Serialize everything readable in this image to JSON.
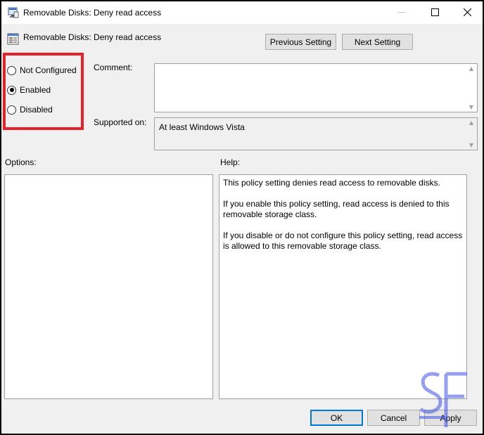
{
  "window": {
    "title": "Removable Disks: Deny read access",
    "controls": {
      "minimize": "—",
      "maximize": "☐",
      "close": "✕"
    }
  },
  "header": {
    "policy_name": "Removable Disks: Deny read access",
    "previous_label": "Previous Setting",
    "next_label": "Next Setting"
  },
  "state": {
    "options": [
      {
        "label": "Not Configured",
        "selected": false
      },
      {
        "label": "Enabled",
        "selected": true
      },
      {
        "label": "Disabled",
        "selected": false
      }
    ],
    "highlight_color": "#e8202a"
  },
  "comment": {
    "label": "Comment:",
    "value": ""
  },
  "supported": {
    "label": "Supported on:",
    "value": "At least Windows Vista"
  },
  "options_panel": {
    "label": "Options:"
  },
  "help_panel": {
    "label": "Help:",
    "paragraphs": [
      "This policy setting denies read access to removable disks.",
      "If you enable this policy setting, read access is denied to this removable storage class.",
      "If you disable or do not configure this policy setting, read access is allowed to this removable storage class."
    ]
  },
  "footer": {
    "ok_label": "OK",
    "cancel_label": "Cancel",
    "apply_label": "Apply"
  },
  "icons": {
    "scroll_up": "▲",
    "scroll_down": "▼"
  },
  "watermark": {
    "text": "SF",
    "color": "#3c50e6"
  }
}
